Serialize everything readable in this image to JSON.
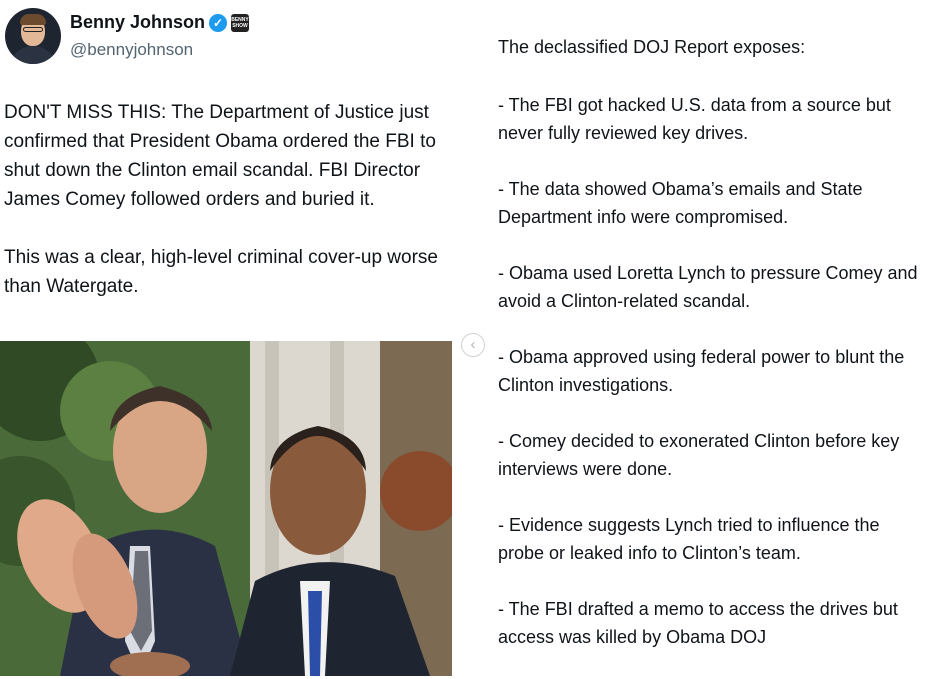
{
  "author": {
    "name": "Benny Johnson",
    "handle": "@bennyjohnson",
    "verified_icon": "verified-check-icon",
    "affiliate_badge": "BENNY SHOW"
  },
  "tweet": {
    "paragraph1": "DON'T MISS THIS: The Department of Justice just confirmed that President Obama ordered the FBI to shut down the Clinton email scandal. FBI Director James Comey followed orders and buried it.",
    "paragraph2": "This was a clear, high-level criminal cover-up worse than Watergate."
  },
  "carousel": {
    "prev_icon": "chevron-left-icon",
    "prev_glyph": "‹"
  },
  "report": {
    "title": "The declassified DOJ Report exposes:",
    "bullets": [
      "- The FBI got hacked U.S. data from a source but never fully reviewed key drives.",
      "- The data showed Obama’s emails and State Department info were compromised.",
      "- Obama used Loretta Lynch to pressure Comey and avoid a Clinton-related scandal.",
      "- Obama approved using federal power to blunt the Clinton investigations.",
      "- Comey decided to exonerated Clinton before key interviews were done.",
      "- Evidence suggests Lynch tried to influence the probe or leaked info to Clinton’s team.",
      "- The FBI drafted a memo to access the drives but access was killed by Obama DOJ"
    ]
  }
}
